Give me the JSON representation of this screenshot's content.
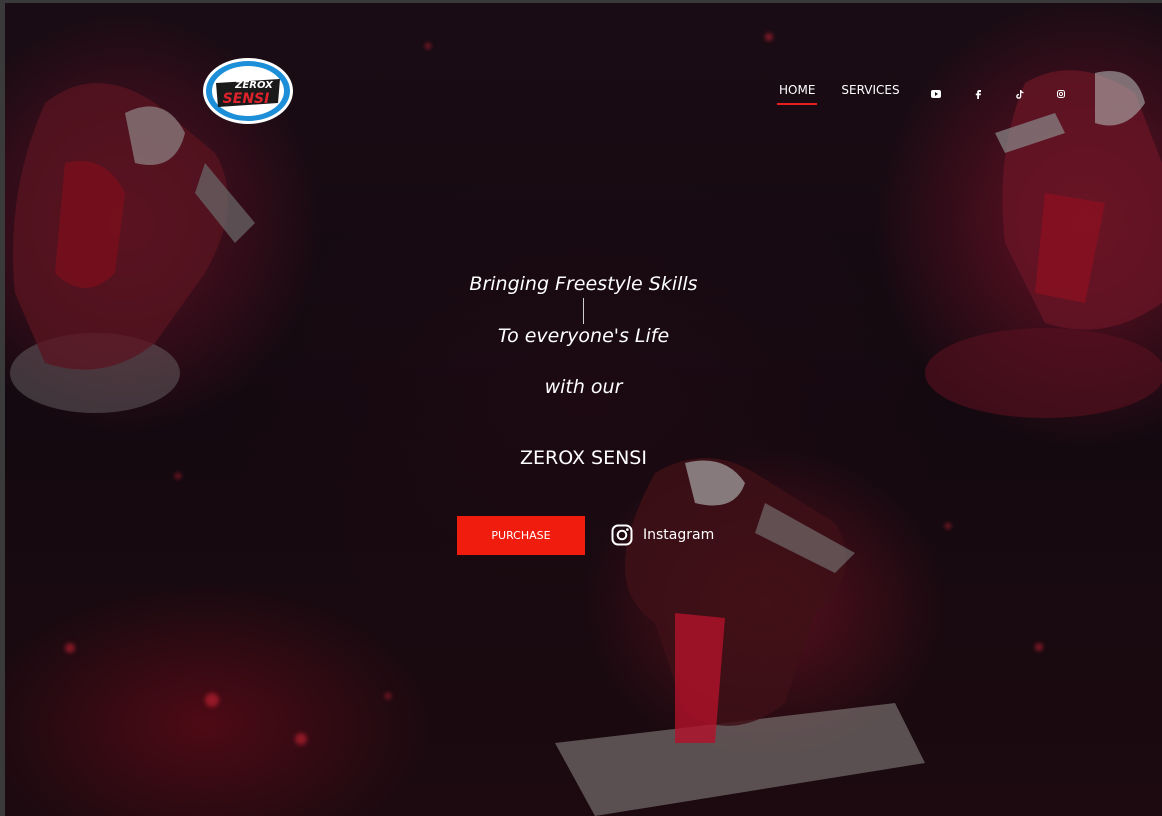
{
  "header": {
    "logo_text_top": "ZEROX",
    "logo_text_bottom": "SENSI",
    "nav": [
      {
        "label": "HOME",
        "active": true
      },
      {
        "label": "SERVICES",
        "active": false
      }
    ],
    "social_icons": [
      "youtube-icon",
      "facebook-icon",
      "tiktok-icon",
      "instagram-icon"
    ]
  },
  "hero": {
    "line1": "Bringing Freestyle Skills",
    "line2": "To everyone's Life",
    "line3": "with our",
    "brand": "ZEROX SENSI",
    "purchase_label": "PURCHASE",
    "instagram_label": "Instagram"
  },
  "colors": {
    "accent": "#f01d0f",
    "nav_underline": "#e61e1e",
    "text": "#ffffff"
  }
}
